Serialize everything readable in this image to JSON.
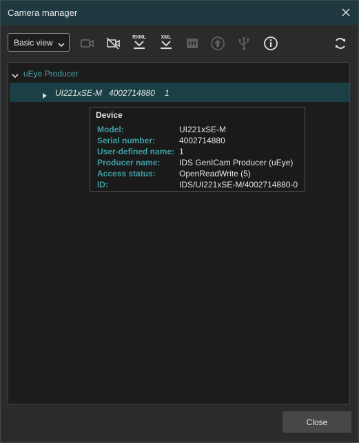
{
  "window": {
    "title": "Camera manager"
  },
  "toolbar": {
    "view_select": {
      "selected": "Basic view"
    },
    "icons": [
      {
        "name": "open-camera-icon",
        "enabled": false
      },
      {
        "name": "close-camera-icon",
        "enabled": true
      },
      {
        "name": "rxml-import-icon",
        "label": "RXML",
        "enabled": true
      },
      {
        "name": "xml-import-icon",
        "label": "XML",
        "enabled": true
      },
      {
        "name": "network-config-icon",
        "enabled": false
      },
      {
        "name": "firmware-update-icon",
        "enabled": false
      },
      {
        "name": "usb-icon",
        "enabled": false
      },
      {
        "name": "info-icon",
        "enabled": true
      },
      {
        "name": "refresh-icon",
        "enabled": true
      }
    ]
  },
  "tree": {
    "producer": "uEye Producer",
    "device": {
      "model": "UI221xSE-M",
      "serial": "4002714880",
      "user_name": "1"
    }
  },
  "tooltip": {
    "title": "Device",
    "rows": [
      {
        "key": "Model:",
        "value": "UI221xSE-M"
      },
      {
        "key": "Serial number:",
        "value": "4002714880"
      },
      {
        "key": "User-defined name:",
        "value": "1"
      },
      {
        "key": "Producer name:",
        "value": "IDS GenICam Producer (uEye)"
      },
      {
        "key": "Access status:",
        "value": "OpenReadWrite (5)"
      },
      {
        "key": "ID:",
        "value": "IDS/UI221xSE-M/4002714880-0"
      }
    ]
  },
  "footer": {
    "close_label": "Close"
  },
  "colors": {
    "titlebar": "#1e3a40",
    "accent": "#3d9ea4",
    "selected_row": "#1a4046",
    "panel": "#1c1c1c"
  }
}
